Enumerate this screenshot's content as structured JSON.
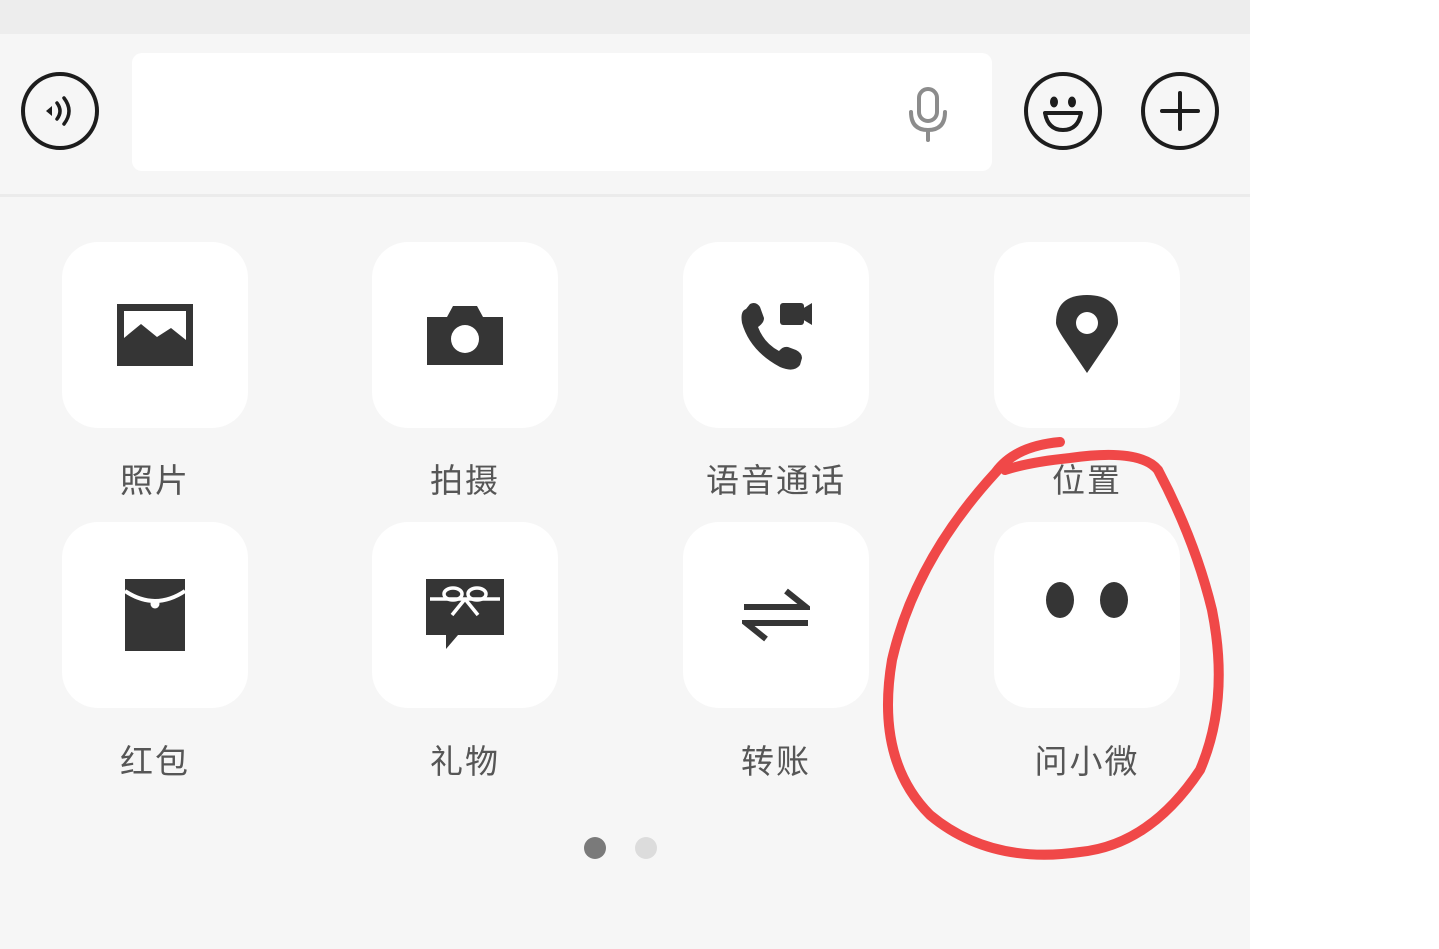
{
  "input_bar": {
    "text_value": "",
    "voice_toggle_icon": "voice-wave-icon",
    "mic_icon": "microphone-icon",
    "emoji_icon": "smiley-face-icon",
    "more_icon": "plus-circle-icon"
  },
  "panel": {
    "items": [
      {
        "label": "照片",
        "icon": "picture-icon"
      },
      {
        "label": "拍摄",
        "icon": "camera-icon"
      },
      {
        "label": "语音通话",
        "icon": "voice-video-call-icon"
      },
      {
        "label": "位置",
        "icon": "location-pin-icon"
      },
      {
        "label": "红包",
        "icon": "red-packet-icon"
      },
      {
        "label": "礼物",
        "icon": "gift-icon"
      },
      {
        "label": "转账",
        "icon": "transfer-arrows-icon"
      },
      {
        "label": "问小微",
        "icon": "two-dots-assistant-icon"
      }
    ],
    "pagination": {
      "current_page": 1,
      "total_pages": 2
    }
  },
  "colors": {
    "background": "#f6f6f6",
    "tile": "#ffffff",
    "icon": "#353535",
    "label": "#565656",
    "annotation": "#f04848",
    "dot_active": "#7a7a7a",
    "dot_inactive": "#dcdcdc"
  }
}
